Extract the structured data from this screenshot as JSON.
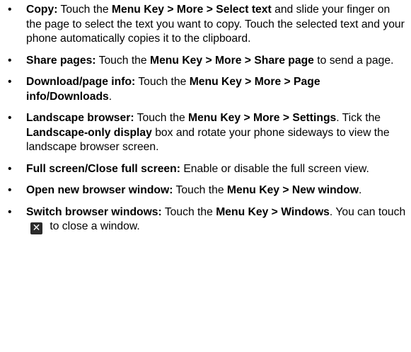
{
  "items": [
    {
      "bold_label": "Copy:",
      "parts": [
        " Touch the ",
        "Menu Key > More > Select text",
        " and slide your finger on the page to select the text you want to copy. Touch the selected text and your phone automatically copies it to the clipboard."
      ]
    },
    {
      "bold_label": "Share pages:",
      "parts": [
        " Touch the ",
        "Menu Key > More > Share page",
        " to send a page."
      ]
    },
    {
      "bold_label": "Download/page info:",
      "parts": [
        " Touch the ",
        "Menu Key > More > Page info/Downloads",
        "."
      ]
    },
    {
      "bold_label": "Landscape browser:",
      "parts": [
        " Touch the ",
        "Menu Key > More > Settings",
        ". Tick the ",
        "Landscape-only display",
        " box and rotate your phone sideways to view the landscape browser screen."
      ]
    },
    {
      "bold_label": "Full screen/Close full screen:",
      "parts": [
        " Enable or disable the full screen view."
      ]
    },
    {
      "bold_label": "Open new browser window:",
      "parts": [
        " Touch the ",
        "Menu Key > New window",
        "."
      ]
    },
    {
      "bold_label": "Switch browser windows:",
      "parts": [
        " Touch the ",
        "Menu Key > Windows",
        ". You can touch ",
        " to close a window."
      ],
      "icon": "close-window-icon",
      "icon_glyph": "✕"
    }
  ],
  "bullet_glyph": "•"
}
